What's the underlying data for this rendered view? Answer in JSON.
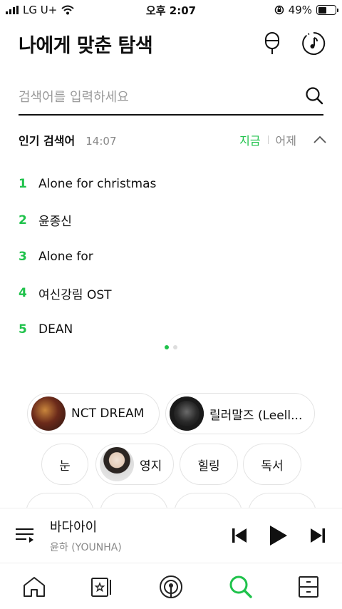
{
  "status_bar": {
    "carrier": "LG U+",
    "time": "오후 2:07",
    "battery": "49%"
  },
  "header": {
    "title": "나에게 맞춘 탐색"
  },
  "search": {
    "placeholder": "검색어를 입력하세요"
  },
  "popular": {
    "title": "인기 검색어",
    "time": "14:07",
    "tab_now": "지금",
    "tab_yesterday": "어제",
    "items": [
      {
        "rank": "1",
        "text": "Alone for christmas"
      },
      {
        "rank": "2",
        "text": "윤종신"
      },
      {
        "rank": "3",
        "text": "Alone for"
      },
      {
        "rank": "4",
        "text": "여신강림 OST"
      },
      {
        "rank": "5",
        "text": "DEAN"
      }
    ]
  },
  "chips": {
    "artists": [
      {
        "label": "NCT DREAM"
      },
      {
        "label": "릴러말즈 (Leell..."
      }
    ],
    "tags": [
      {
        "label": "눈"
      },
      {
        "label": "영지"
      },
      {
        "label": "힐링"
      },
      {
        "label": "독서"
      }
    ]
  },
  "player": {
    "title": "바다아이",
    "artist": "윤하 (YOUNHA)"
  },
  "colors": {
    "accent": "#1fc24b"
  }
}
